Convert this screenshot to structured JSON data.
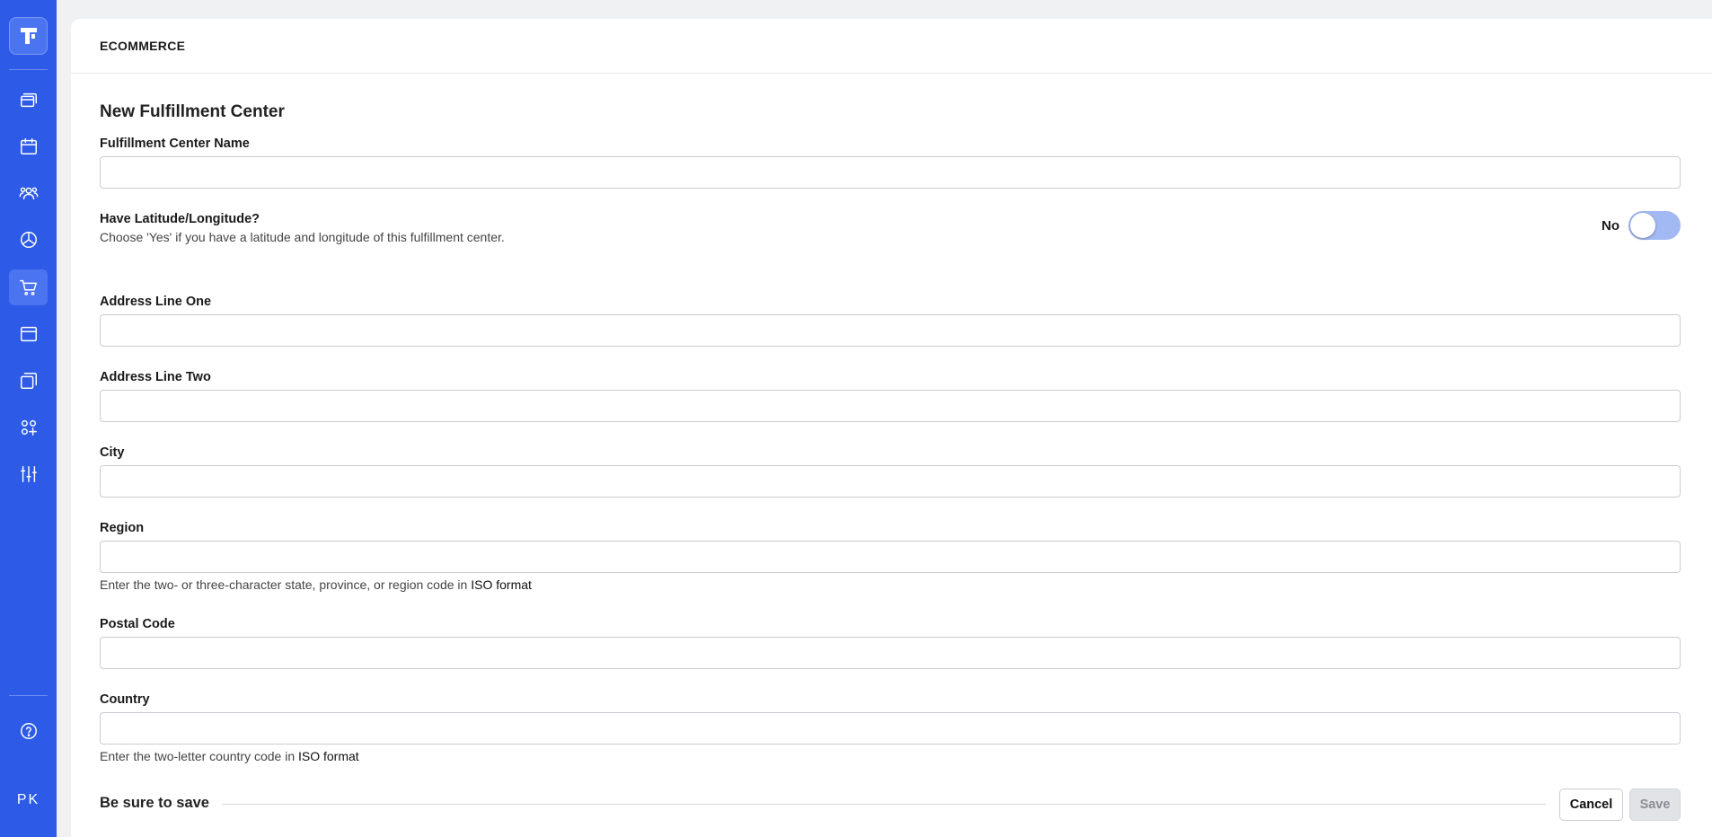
{
  "sidebar": {
    "items": [
      {
        "name": "pages",
        "icon": "stacked-windows-icon"
      },
      {
        "name": "calendar",
        "icon": "calendar-icon"
      },
      {
        "name": "users",
        "icon": "users-icon"
      },
      {
        "name": "analytics",
        "icon": "pie-chart-icon"
      },
      {
        "name": "ecommerce",
        "icon": "shopping-cart-icon",
        "active": true
      },
      {
        "name": "browser",
        "icon": "browser-window-icon"
      },
      {
        "name": "copies",
        "icon": "copy-icon"
      },
      {
        "name": "apps",
        "icon": "apps-plus-icon"
      },
      {
        "name": "settings",
        "icon": "sliders-icon"
      }
    ],
    "help_icon": "help-circle-icon",
    "avatar_initials": "PK"
  },
  "header": {
    "section": "ECOMMERCE"
  },
  "form": {
    "title": "New Fulfillment Center",
    "name_label": "Fulfillment Center Name",
    "name_value": "",
    "latlng_label": "Have Latitude/Longitude?",
    "latlng_help": "Choose 'Yes' if you have a latitude and longitude of this fulfillment center.",
    "latlng_state": "No",
    "address1_label": "Address Line One",
    "address1_value": "",
    "address2_label": "Address Line Two",
    "address2_value": "",
    "city_label": "City",
    "city_value": "",
    "region_label": "Region",
    "region_value": "",
    "region_help": "Enter the two- or three-character state, province, or region code in ",
    "region_help_link": "ISO format",
    "postal_label": "Postal Code",
    "postal_value": "",
    "country_label": "Country",
    "country_value": "",
    "country_help": "Enter the two-letter country code in ",
    "country_help_link": "ISO format"
  },
  "footer": {
    "save_reminder": "Be sure to save",
    "cancel_label": "Cancel",
    "save_label": "Save"
  },
  "colors": {
    "sidebar_bg": "#2d5ae6",
    "toggle_off": "#a3b9f4"
  }
}
